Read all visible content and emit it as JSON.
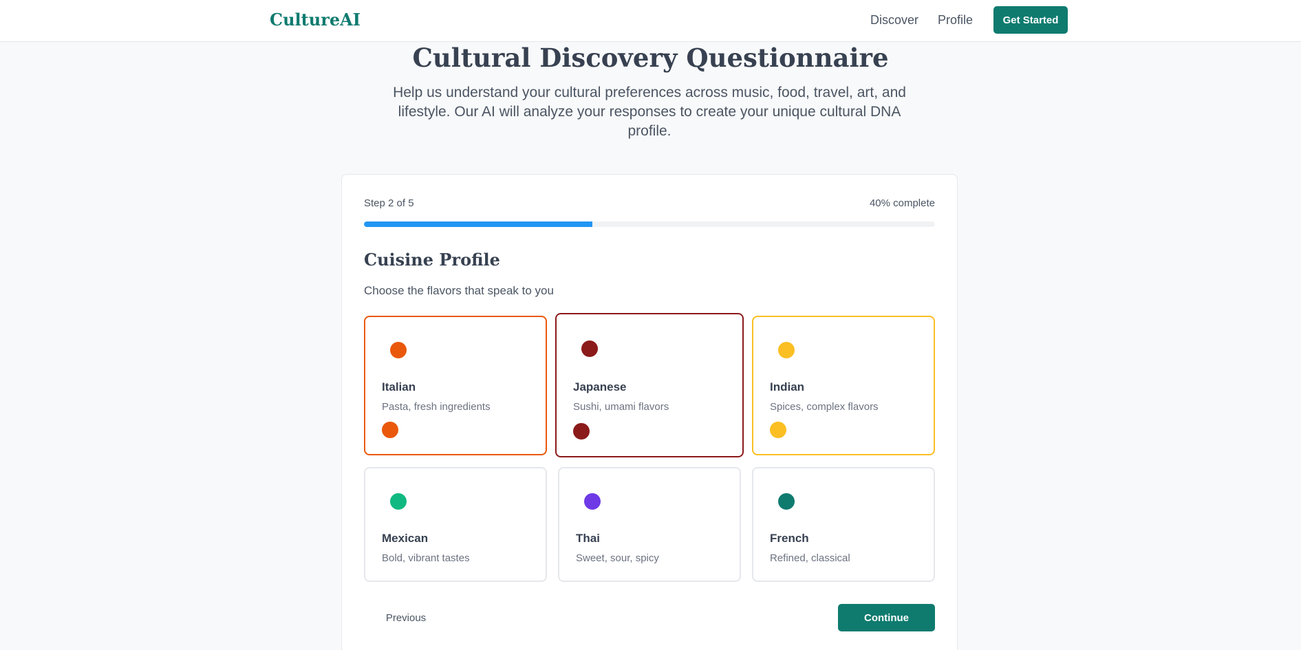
{
  "navbar": {
    "brand": "CultureAI",
    "links": [
      "Discover",
      "Profile"
    ],
    "cta_label": "Get Started",
    "accent_color": "#0f7b6f"
  },
  "hero": {
    "title": "Cultural Discovery Questionnaire",
    "subtitle": "Help us understand your cultural preferences across music, food, travel, art, and lifestyle. Our AI will analyze your responses to create your unique cultural DNA profile."
  },
  "progress": {
    "step_label": "Step 2 of 5",
    "percent_label": "40% complete",
    "percent": 40,
    "color": "#2196f3"
  },
  "section": {
    "title": "Cuisine Profile",
    "subtitle": "Choose the flavors that speak to you"
  },
  "options": [
    {
      "name": "Italian",
      "description": "Pasta, fresh ingredients",
      "color": "#ea580c",
      "selected": true
    },
    {
      "name": "Japanese",
      "description": "Sushi, umami flavors",
      "color": "#8b1a1a",
      "selected": true
    },
    {
      "name": "Indian",
      "description": "Spices, complex flavors",
      "color": "#fbbf24",
      "selected": true
    },
    {
      "name": "Mexican",
      "description": "Bold, vibrant tastes",
      "color": "#10b981",
      "selected": false
    },
    {
      "name": "Thai",
      "description": "Sweet, sour, spicy",
      "color": "#6d3ae6",
      "selected": false
    },
    {
      "name": "French",
      "description": "Refined, classical",
      "color": "#0f7b6f",
      "selected": false
    }
  ],
  "actions": {
    "previous_label": "Previous",
    "continue_label": "Continue"
  }
}
